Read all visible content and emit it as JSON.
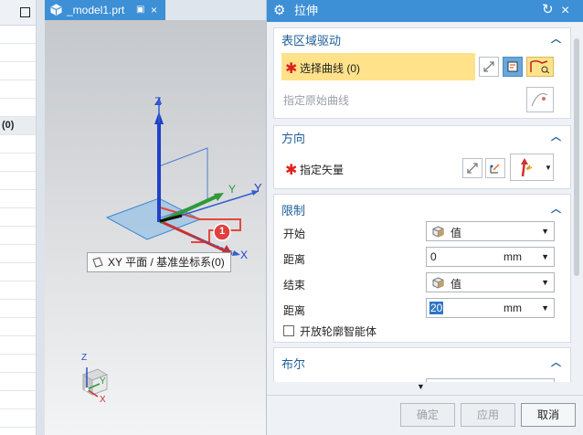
{
  "left_panel": {
    "rows": [
      "",
      "",
      "",
      "",
      "",
      "(0)",
      "",
      "",
      "",
      "",
      "",
      "",
      "",
      "",
      "",
      "",
      "",
      "",
      "",
      "",
      "",
      ""
    ]
  },
  "tab": {
    "title": "_model1.prt",
    "close_glyph": "×"
  },
  "viewport": {
    "tooltip": "XY 平面 / 基准坐标系(0)",
    "badge": "1",
    "axes": {
      "x": "X",
      "y": "Y",
      "z": "Z"
    },
    "mini_axes": {
      "x": "X",
      "y": "Y",
      "z": "Z"
    }
  },
  "dialog": {
    "title": "拉伸",
    "reset_glyph": "↻",
    "close_glyph": "×",
    "sections": {
      "section_drive": {
        "label": "表区域驱动",
        "select_curve": "选择曲线 (0)",
        "specify_origin": "指定原始曲线"
      },
      "direction": {
        "label": "方向",
        "specify_vector": "指定矢量"
      },
      "limits": {
        "label": "限制",
        "start_label": "开始",
        "start_option": "值",
        "start_distance_label": "距离",
        "start_distance": "0",
        "start_unit": "mm",
        "end_label": "结束",
        "end_option": "值",
        "end_distance_label": "距离",
        "end_distance": "20",
        "end_unit": "mm",
        "open_profile": "开放轮廓智能体"
      },
      "boolean": {
        "label": "布尔"
      }
    },
    "footer": {
      "ok": "确定",
      "apply": "应用",
      "cancel": "取消"
    }
  },
  "colors": {
    "accent": "#3d8fd6",
    "highlight": "#ffe28a",
    "section_title": "#1f5e99",
    "required_star": "#e02020"
  },
  "icons": [
    "gear-icon",
    "reset-icon",
    "close-icon",
    "curve-select-icon",
    "vector-icon",
    "cube-icon",
    "chevron-up-icon",
    "dropdown-arrow-icon"
  ]
}
